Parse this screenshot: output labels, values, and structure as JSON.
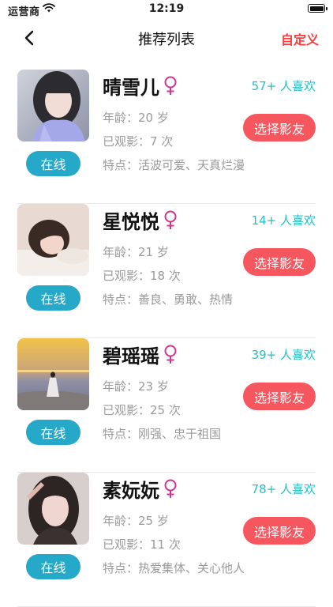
{
  "status": {
    "carrier": "运营商",
    "time": "12:19"
  },
  "nav": {
    "title": "推荐列表",
    "right": "自定义"
  },
  "users": [
    {
      "name": "晴雪儿",
      "likes": "57+ 人喜欢",
      "age": "年龄：20 岁",
      "watched": "已观影：7 次",
      "traits": "特点：活波可爱、天真烂漫",
      "online": "在线",
      "select": "选择影友"
    },
    {
      "name": "星悦悦",
      "likes": "14+ 人喜欢",
      "age": "年龄：21 岁",
      "watched": "已观影：18 次",
      "traits": "特点：善良、勇敢、热情",
      "online": "在线",
      "select": "选择影友"
    },
    {
      "name": "碧瑶瑶",
      "likes": "39+ 人喜欢",
      "age": "年龄：23 岁",
      "watched": "已观影：25 次",
      "traits": "特点：刚强、忠于祖国",
      "online": "在线",
      "select": "选择影友"
    },
    {
      "name": "素妧妧",
      "likes": "78+ 人喜欢",
      "age": "年龄：25 岁",
      "watched": "已观影：11 次",
      "traits": "特点：热爱集体、关心他人",
      "online": "在线",
      "select": "选择影友"
    }
  ],
  "icons": {
    "back": "chevron-left-icon",
    "gender": "female-symbol-icon",
    "wifi": "wifi-icon",
    "battery": "battery-icon"
  },
  "colors": {
    "accent_red": "#f6575f",
    "custom_red": "#ff3b3b",
    "online_teal": "#26a9c8",
    "likes_cyan": "#22c0c8",
    "female_pink": "#d6338f"
  }
}
